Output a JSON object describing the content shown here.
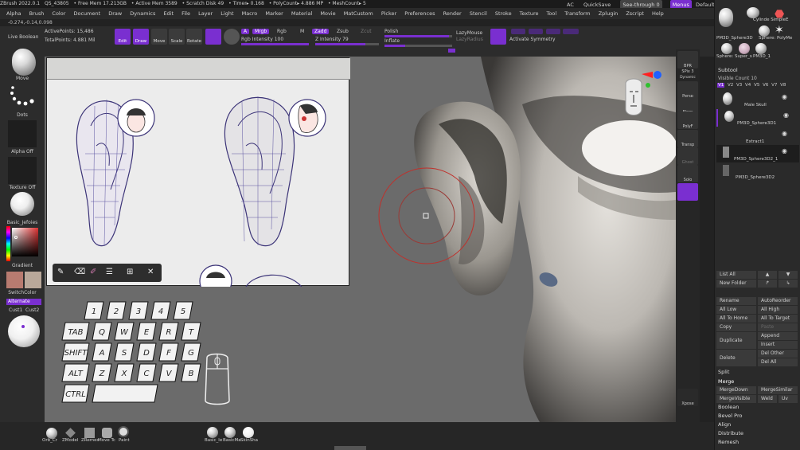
{
  "titlebar": {
    "items": [
      "ZBrush 2022.0.1",
      "QS_43805",
      "• Free Mem 17.213GB",
      "• Active Mem 3589",
      "• Scratch Disk 49",
      "• Timer▸ 0.168",
      "• PolyCount▸ 4.886 MP",
      "• MeshCount▸ 5"
    ]
  },
  "topright": {
    "ac": "AC",
    "quicksave": "QuickSave",
    "seethrough": "See-through  0",
    "menus": "Menus",
    "script": "DefaultZScript"
  },
  "menubar": {
    "items": [
      "Alpha",
      "Brush",
      "Color",
      "Document",
      "Draw",
      "Dynamics",
      "Edit",
      "File",
      "Layer",
      "Light",
      "Macro",
      "Marker",
      "Material",
      "Movie",
      "MatCustom",
      "Picker",
      "Preferences",
      "Render",
      "Stencil",
      "Stroke",
      "Texture",
      "Tool",
      "Transform",
      "Zplugin",
      "Zscript",
      "Help"
    ]
  },
  "coords": "-0.274,-0.14,0.098",
  "toolshelf": {
    "live_boolean": "Live Boolean",
    "active_points": "ActivePoints: 15,486",
    "total_points": "TotalPoints: 4.881 Mil",
    "edit": "Edit",
    "draw": "Draw",
    "move": "Move",
    "scale": "Scale",
    "rotate": "Rotate",
    "a": "A",
    "mrgb": "Mrgb",
    "rgb": "Rgb",
    "m": "M",
    "zadd": "Zadd",
    "zsub": "Zsub",
    "zcut": "Zcut",
    "rgb_intensity": "Rgb Intensity 100",
    "z_intensity": "Z Intensity 79",
    "polish": "Polish",
    "inflate": "Inflate",
    "lazymouse": "LazyMouse",
    "lazyradius": "LazyRadius",
    "activate_symmetry": "Activate Symmetry",
    "polish_value": 0.95,
    "inflate_value": 0.3,
    "rgb_intensity_value": 1.0,
    "z_intensity_value": 0.79
  },
  "leftpanel": {
    "brush": "Move",
    "stroke": "Dots",
    "alpha": "Alpha Off",
    "texture": "Texture Off",
    "material": "Basic_Jefoies",
    "gradient": "Gradient",
    "switchcolor": "SwitchColor",
    "alternate": "Alternate",
    "cust1": "Cust1",
    "cust2": "Cust2"
  },
  "refbar_icons": [
    "pencil-icon",
    "eraser-icon",
    "highlighter-icon",
    "menu-icon",
    "grid-icon",
    "close-icon"
  ],
  "keyboard": {
    "row1": [
      "1",
      "2",
      "3",
      "4",
      "5"
    ],
    "row2": [
      "TAB",
      "Q",
      "W",
      "E",
      "R",
      "T"
    ],
    "row3": [
      "SHIFT",
      "A",
      "S",
      "D",
      "F",
      "G"
    ],
    "row4": [
      "ALT",
      "Z",
      "X",
      "C",
      "V",
      "B"
    ],
    "row5": [
      "CTRL",
      ""
    ]
  },
  "rightshelf": {
    "bpr": "BPR",
    "spix": "SPix 3",
    "dynamic": "Dynamic",
    "persp": "Persp",
    "floor": "Floor",
    "local": "Local",
    "polyf": "PolyF",
    "transp": "Transp",
    "ghost": "Ghost",
    "solo": "Solo",
    "xpose": "Xpose"
  },
  "rightpanel": {
    "thumbs": [
      "Cylinde SimpleE",
      "PM3D_Sphere3D",
      "Sphere: PolyMe",
      "Sphere: Super_s",
      "PM3D_1"
    ],
    "subtool_title": "Subtool",
    "visible_count": "Visible Count 10",
    "v_labels": [
      "V1",
      "V2",
      "V3",
      "V4",
      "V5",
      "V6",
      "V7",
      "V8"
    ],
    "subtools": [
      "Male Skull",
      "PM3D_Sphere3D1",
      "Extract1",
      "PM3D_Sphere3D2_1",
      "PM3D_Sphere3D2"
    ],
    "list_all": "List All",
    "new_folder": "New Folder",
    "rename": "Rename",
    "autoreorder": "AutoReorder",
    "all_low": "All Low",
    "all_high": "All High",
    "all_to_home": "All To Home",
    "all_to_target": "All To Target",
    "copy": "Copy",
    "paste": "Paste",
    "duplicate": "Duplicate",
    "append": "Append",
    "insert": "Insert",
    "delete": "Delete",
    "del_other": "Del Other",
    "del_all": "Del All",
    "split": "Split",
    "merge": "Merge",
    "mergedown": "MergeDown",
    "mergesimilar": "MergeSimilar",
    "mergevisible": "MergeVisible",
    "weld": "Weld",
    "uv": "Uv",
    "boolean": "Boolean",
    "bevel_pro": "Bevel Pro",
    "align": "Align",
    "distribute": "Distribute",
    "remesh": "Remesh"
  },
  "bottombar": {
    "items": [
      "Orb_Cr",
      "ZModel",
      "ZRemes",
      "Move Tc",
      "Paint",
      "Basic_le",
      "BasicMa",
      "SkinSha"
    ]
  },
  "colors": {
    "accent": "#7a2fd0",
    "primary_color": "#b87b70",
    "secondary_color": "#b9a89a"
  }
}
